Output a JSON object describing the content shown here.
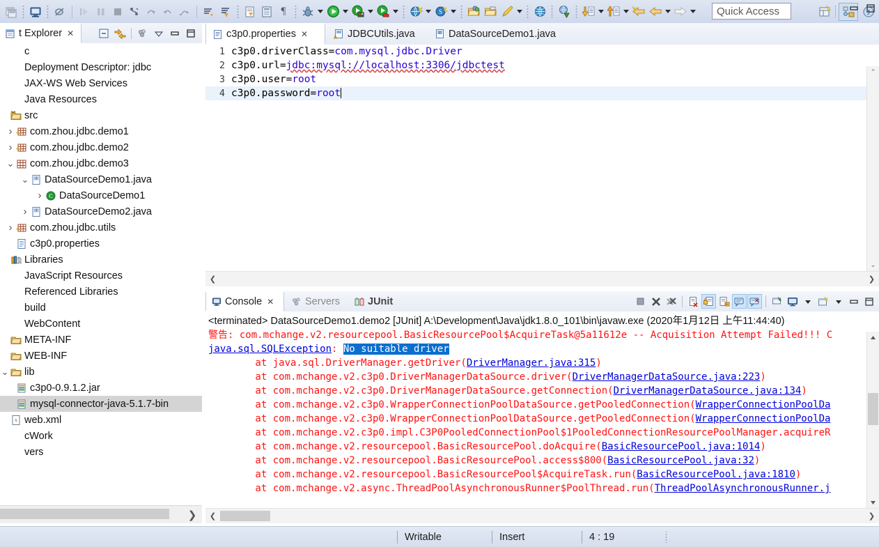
{
  "toolbar": {
    "quick_access_placeholder": "Quick Access",
    "icons": [
      "save-all-icon",
      "sep",
      "console-view-icon",
      "sep",
      "skip-breakpoints-icon",
      "bar",
      "resume-icon",
      "suspend-icon",
      "terminate-icon",
      "step-into-icon",
      "step-over-icon",
      "step-return-icon",
      "drop-to-frame-icon",
      "bar",
      "open-task-icon",
      "open-type-icon",
      "sep",
      "new-java-class-icon",
      "open-element-icon",
      "show-whitespace-icon",
      "sep",
      "debug-icon",
      "debug-dropdown",
      "run-icon",
      "run-dropdown",
      "run-as-server-icon",
      "run-server-dropdown",
      "coverage-icon",
      "coverage-dropdown",
      "sep",
      "new-wizard-icon",
      "new-wizard-dropdown",
      "search-icon",
      "search-dropdown",
      "sep",
      "open-folder-icon",
      "open-package-icon",
      "edit-icon",
      "edit-dropdown",
      "sep",
      "web-browser-icon",
      "sep",
      "link-editor-icon",
      "sep",
      "next-annotation-icon",
      "next-dropdown",
      "prev-annotation-icon",
      "prev-dropdown",
      "back-history-icon",
      "forward-back-icon",
      "forward-dropdown",
      "forward-icon",
      "forward-arrow-dropdown"
    ],
    "right_icons": [
      "perspective-open-icon",
      "java-ee-perspective-icon",
      "java-perspective-icon"
    ]
  },
  "explorer": {
    "tab_label": "t Explorer",
    "tab_close": "✕",
    "tools": [
      "collapse-all-icon",
      "link-with-editor-icon",
      "view-menu-icon",
      "minimize-icon",
      "maximize-icon"
    ],
    "tree": [
      {
        "indent": 0,
        "twist": "",
        "icon": "none",
        "label": "c"
      },
      {
        "indent": 0,
        "twist": "",
        "icon": "none",
        "label": "Deployment Descriptor: jdbc"
      },
      {
        "indent": 0,
        "twist": "",
        "icon": "none",
        "label": "JAX-WS Web Services"
      },
      {
        "indent": 0,
        "twist": "",
        "icon": "none",
        "label": "Java Resources"
      },
      {
        "indent": 0,
        "twist": "",
        "icon": "src-folder",
        "label": "src"
      },
      {
        "indent": 1,
        "twist": "›",
        "icon": "package-empty",
        "label": "com.zhou.jdbc.demo1"
      },
      {
        "indent": 1,
        "twist": "›",
        "icon": "package-empty",
        "label": "com.zhou.jdbc.demo2"
      },
      {
        "indent": 1,
        "twist": "⌄",
        "icon": "package",
        "label": "com.zhou.jdbc.demo3"
      },
      {
        "indent": 2,
        "twist": "⌄",
        "icon": "java-file",
        "label": "DataSourceDemo1.java"
      },
      {
        "indent": 3,
        "twist": "›",
        "icon": "class",
        "label": "DataSourceDemo1"
      },
      {
        "indent": 2,
        "twist": "›",
        "icon": "java-file",
        "label": "DataSourceDemo2.java"
      },
      {
        "indent": 1,
        "twist": "›",
        "icon": "package-empty",
        "label": "com.zhou.jdbc.utils"
      },
      {
        "indent": 1,
        "twist": "",
        "icon": "properties-file",
        "label": "c3p0.properties"
      },
      {
        "indent": 0,
        "twist": "",
        "icon": "libraries",
        "label": "Libraries"
      },
      {
        "indent": 0,
        "twist": "",
        "icon": "none",
        "label": "JavaScript Resources"
      },
      {
        "indent": 0,
        "twist": "",
        "icon": "none",
        "label": "Referenced Libraries"
      },
      {
        "indent": 0,
        "twist": "",
        "icon": "none",
        "label": "build"
      },
      {
        "indent": 0,
        "twist": "",
        "icon": "none",
        "label": "WebContent"
      },
      {
        "indent": 0,
        "twist": "",
        "icon": "folder",
        "label": "META-INF"
      },
      {
        "indent": 0,
        "twist": "",
        "icon": "folder",
        "label": "WEB-INF"
      },
      {
        "indent": 0,
        "twist": "⌄",
        "icon": "folder",
        "label": "lib"
      },
      {
        "indent": 1,
        "twist": "",
        "icon": "jar",
        "label": "c3p0-0.9.1.2.jar"
      },
      {
        "indent": 1,
        "twist": "",
        "icon": "jar",
        "label": "mysql-connector-java-5.1.7-bin",
        "selected": true
      },
      {
        "indent": 0,
        "twist": "",
        "icon": "xml-file",
        "label": "web.xml"
      },
      {
        "indent": 0,
        "twist": "",
        "icon": "none",
        "label": "cWork"
      },
      {
        "indent": 0,
        "twist": "",
        "icon": "none",
        "label": "vers"
      }
    ],
    "hscroll_right_arrow": "❯"
  },
  "editor": {
    "tabs": [
      {
        "label": "c3p0.properties",
        "icon": "properties-file-icon",
        "active": true,
        "close": "✕"
      },
      {
        "label": "JDBCUtils.java",
        "icon": "java-warning-icon",
        "active": false
      },
      {
        "label": "DataSourceDemo1.java",
        "icon": "java-file-icon",
        "active": false
      }
    ],
    "window_buttons": [
      "minimize-icon",
      "maximize-icon"
    ],
    "lines": [
      {
        "no": "1",
        "key": "c3p0.driverClass=",
        "val": "com.mysql.jdbc.Driver",
        "squig": false,
        "current": false
      },
      {
        "no": "2",
        "key": "c3p0.url=",
        "val": "jdbc:mysql://localhost:3306/jdbctest",
        "squig": true,
        "current": false
      },
      {
        "no": "3",
        "key": "c3p0.user=",
        "val": "root",
        "squig": false,
        "current": false
      },
      {
        "no": "4",
        "key": "c3p0.password=",
        "val": "root",
        "squig": false,
        "current": true
      }
    ],
    "scroll_up": "⌃",
    "scroll_down": "⌄",
    "hscroll_left": "❮",
    "hscroll_right": "❯"
  },
  "console": {
    "tabs": [
      {
        "label": "Console",
        "icon": "console-icon",
        "active": true,
        "close": "✕"
      },
      {
        "label": "Servers",
        "icon": "servers-icon",
        "active": false,
        "dim": true
      },
      {
        "label": "JUnit",
        "icon": "junit-icon",
        "active": false,
        "bold": true
      }
    ],
    "tools": [
      {
        "name": "terminate-icon",
        "on": false
      },
      {
        "name": "remove-launch-icon",
        "on": false
      },
      {
        "name": "remove-all-launches-icon",
        "on": false
      },
      {
        "name": "separator",
        "on": false
      },
      {
        "name": "clear-console-icon",
        "on": false
      },
      {
        "name": "scroll-lock-icon",
        "on": true
      },
      {
        "name": "show-console-on-output-icon",
        "on": false
      },
      {
        "name": "pin-console-icon",
        "on": true
      },
      {
        "name": "display-selected-console-icon",
        "on": true
      },
      {
        "name": "separator",
        "on": false
      },
      {
        "name": "open-console-icon",
        "on": false
      },
      {
        "name": "display-console-icon",
        "on": false
      },
      {
        "name": "display-console-dropdown",
        "on": false
      },
      {
        "name": "new-console-view-icon",
        "on": false
      },
      {
        "name": "new-console-dropdown",
        "on": false
      },
      {
        "name": "minimize-icon",
        "on": false
      },
      {
        "name": "maximize-icon",
        "on": false
      }
    ],
    "header": "<terminated> DataSourceDemo1.demo2 [JUnit] A:\\Development\\Java\\jdk1.8.0_101\\bin\\javaw.exe (2020年1月12日 上午11:44:40)",
    "lines": [
      {
        "segments": [
          {
            "t": "警告: com.mchange.v2.resourcepool.BasicResourcePool$AcquireTask@5a11612e -- Acquisition Attempt Failed!!! C",
            "s": "plain"
          }
        ]
      },
      {
        "segments": [
          {
            "t": "java.sql.SQLException",
            "s": "link"
          },
          {
            "t": ": ",
            "s": "plain"
          },
          {
            "t": "No suitable driver",
            "s": "hl"
          }
        ]
      },
      {
        "segments": [
          {
            "t": "\tat java.sql.DriverManager.getDriver(",
            "s": "plain"
          },
          {
            "t": "DriverManager.java:315",
            "s": "link"
          },
          {
            "t": ")",
            "s": "plain"
          }
        ]
      },
      {
        "segments": [
          {
            "t": "\tat com.mchange.v2.c3p0.DriverManagerDataSource.driver(",
            "s": "plain"
          },
          {
            "t": "DriverManagerDataSource.java:223",
            "s": "link"
          },
          {
            "t": ")",
            "s": "plain"
          }
        ]
      },
      {
        "segments": [
          {
            "t": "\tat com.mchange.v2.c3p0.DriverManagerDataSource.getConnection(",
            "s": "plain"
          },
          {
            "t": "DriverManagerDataSource.java:134",
            "s": "link"
          },
          {
            "t": ")",
            "s": "plain"
          }
        ]
      },
      {
        "segments": [
          {
            "t": "\tat com.mchange.v2.c3p0.WrapperConnectionPoolDataSource.getPooledConnection(",
            "s": "plain"
          },
          {
            "t": "WrapperConnectionPoolDa",
            "s": "link"
          }
        ]
      },
      {
        "segments": [
          {
            "t": "\tat com.mchange.v2.c3p0.WrapperConnectionPoolDataSource.getPooledConnection(",
            "s": "plain"
          },
          {
            "t": "WrapperConnectionPoolDa",
            "s": "link"
          }
        ]
      },
      {
        "segments": [
          {
            "t": "\tat com.mchange.v2.c3p0.impl.C3P0PooledConnectionPool$1PooledConnectionResourcePoolManager.acquireR",
            "s": "plain"
          }
        ]
      },
      {
        "segments": [
          {
            "t": "\tat com.mchange.v2.resourcepool.BasicResourcePool.doAcquire(",
            "s": "plain"
          },
          {
            "t": "BasicResourcePool.java:1014",
            "s": "link"
          },
          {
            "t": ")",
            "s": "plain"
          }
        ]
      },
      {
        "segments": [
          {
            "t": "\tat com.mchange.v2.resourcepool.BasicResourcePool.access$800(",
            "s": "plain"
          },
          {
            "t": "BasicResourcePool.java:32",
            "s": "link"
          },
          {
            "t": ")",
            "s": "plain"
          }
        ]
      },
      {
        "segments": [
          {
            "t": "\tat com.mchange.v2.resourcepool.BasicResourcePool$AcquireTask.run(",
            "s": "plain"
          },
          {
            "t": "BasicResourcePool.java:1810",
            "s": "link"
          },
          {
            "t": ")",
            "s": "plain"
          }
        ]
      },
      {
        "segments": [
          {
            "t": "\tat com.mchange.v2.async.ThreadPoolAsynchronousRunner$PoolThread.run(",
            "s": "plain"
          },
          {
            "t": "ThreadPoolAsynchronousRunner.j",
            "s": "link"
          }
        ]
      }
    ],
    "hscroll_left": "❮",
    "hscroll_right": "❯"
  },
  "status_bar": {
    "writable": "Writable",
    "insert": "Insert",
    "position": "4 : 19"
  },
  "colors": {
    "toolbar_bg": "#d7dff0",
    "error_red": "#ff1111",
    "link_blue": "#0000d8",
    "string_purple": "#2a00d0",
    "selection_blue": "#0a6ecf",
    "tree_selection": "#d4d4d4",
    "current_line": "#eaf2fb"
  }
}
